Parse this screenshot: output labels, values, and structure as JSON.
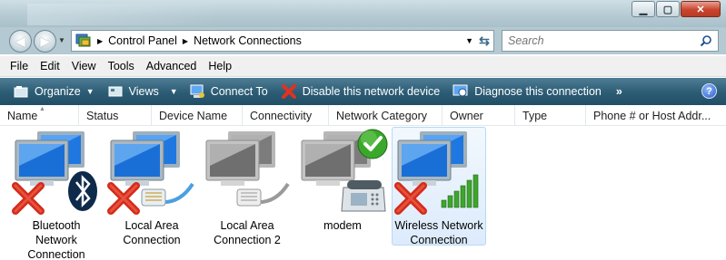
{
  "window": {
    "controls": [
      "minimize",
      "maximize",
      "close"
    ]
  },
  "nav": {
    "back_icon": "back-arrow-icon",
    "forward_icon": "forward-arrow-icon"
  },
  "address": {
    "crumbs": [
      "Control Panel",
      "Network Connections"
    ]
  },
  "search": {
    "placeholder": "Search"
  },
  "menu": {
    "items": [
      "File",
      "Edit",
      "View",
      "Tools",
      "Advanced",
      "Help"
    ]
  },
  "toolbar": {
    "organize": "Organize",
    "views": "Views",
    "connect_to": "Connect To",
    "disable": "Disable this network device",
    "diagnose": "Diagnose this connection",
    "more": "»",
    "help": "?"
  },
  "columns": [
    "Name",
    "Status",
    "Device Name",
    "Connectivity",
    "Network Category",
    "Owner",
    "Type",
    "Phone # or Host Addr..."
  ],
  "items": [
    {
      "line1": "Bluetooth Network",
      "line2": "Connection",
      "overlay": "bluetooth-icon",
      "status_icon": "disconnected-x-icon"
    },
    {
      "line1": "Local Area",
      "line2": "Connection",
      "overlay": "ethernet-plug-icon",
      "status_icon": "disconnected-x-icon"
    },
    {
      "line1": "Local Area",
      "line2": "Connection 2",
      "overlay": "ethernet-plug-icon",
      "status_icon": "disabled"
    },
    {
      "line1": "modem",
      "line2": "",
      "overlay": "telephone-icon",
      "status_icon": "default-check-icon"
    },
    {
      "line1": "Wireless Network",
      "line2": "Connection",
      "overlay": "signal-bars-icon",
      "status_icon": "disconnected-x-icon"
    }
  ],
  "colors": {
    "toolbar": "#2c5c74",
    "selection": "#dcebfc",
    "error": "#d42c1a",
    "check": "#3aa82a"
  }
}
